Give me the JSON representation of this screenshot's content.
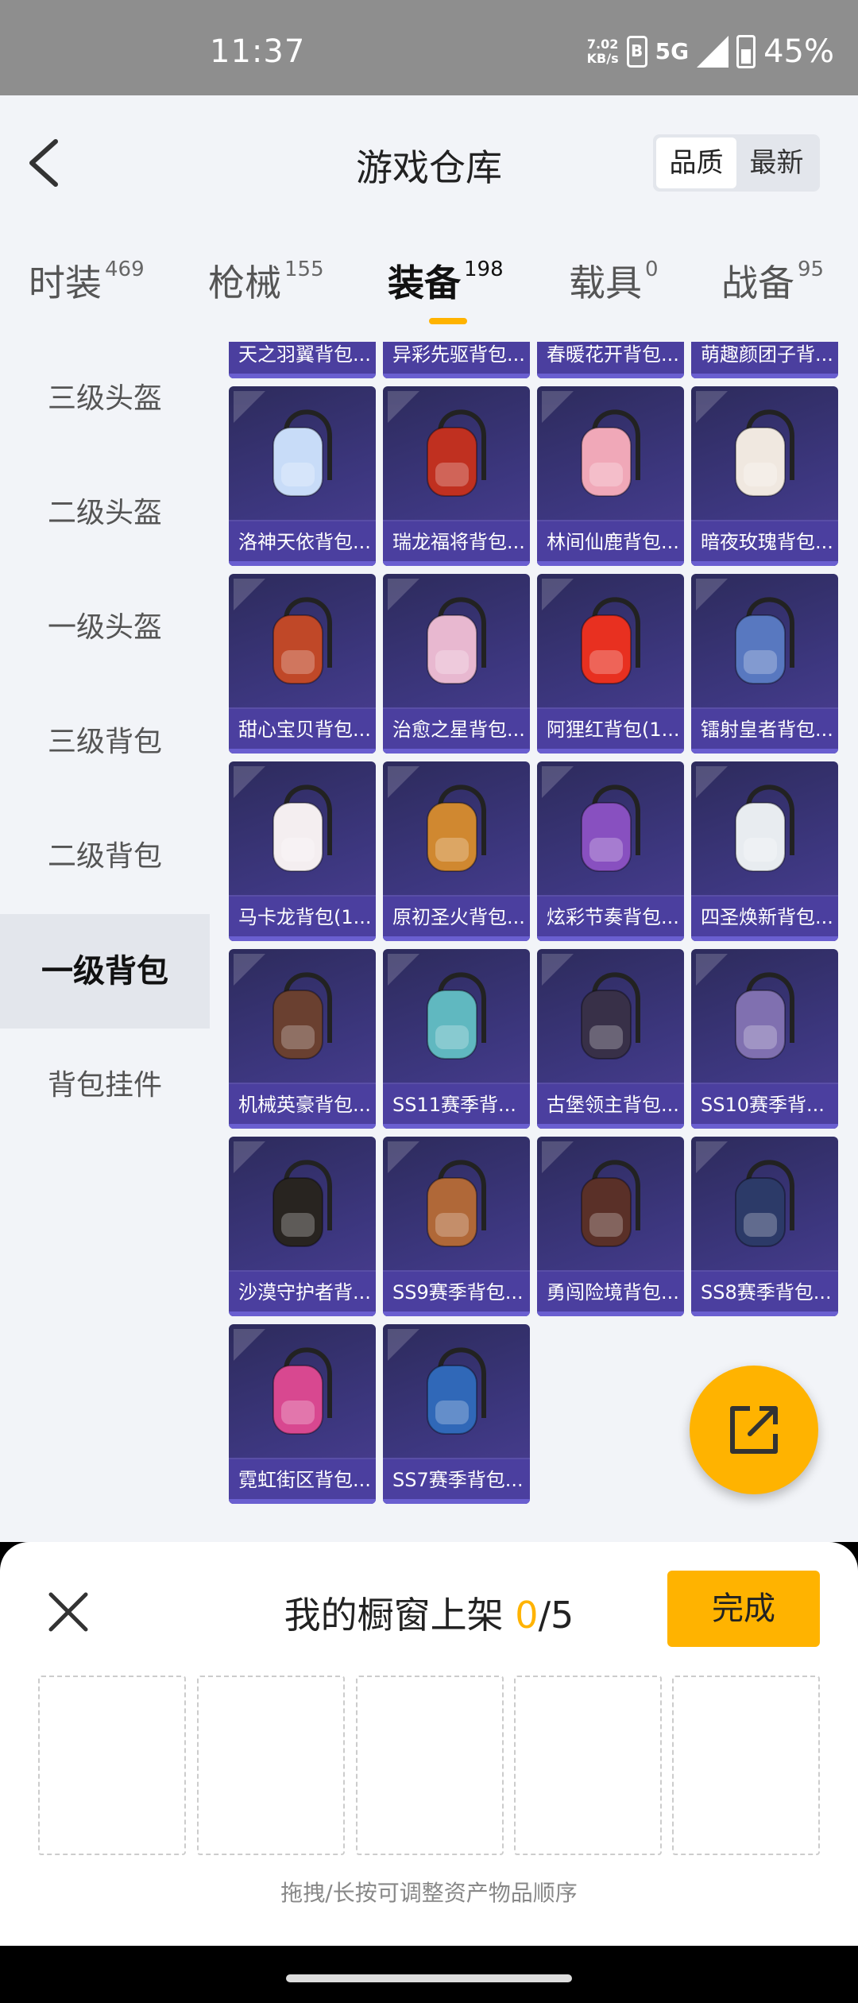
{
  "status_bar": {
    "time": "11:37",
    "net_speed_value": "7.02",
    "net_speed_unit": "KB/s",
    "network": "5G",
    "battery": "45%"
  },
  "header": {
    "title": "游戏仓库",
    "sort_options": [
      "品质",
      "最新"
    ],
    "sort_selected": "品质"
  },
  "tabs": [
    {
      "label": "时装",
      "count": "469"
    },
    {
      "label": "枪械",
      "count": "155"
    },
    {
      "label": "装备",
      "count": "198"
    },
    {
      "label": "载具",
      "count": "0"
    },
    {
      "label": "战备",
      "count": "95"
    }
  ],
  "active_tab": "装备",
  "sidebar": {
    "items": [
      "三级头盔",
      "二级头盔",
      "一级头盔",
      "三级背包",
      "二级背包",
      "一级背包",
      "背包挂件"
    ],
    "active": "一级背包"
  },
  "items": [
    {
      "name": "天之羽翼背包...",
      "icon": "backpack-icon",
      "color": "#a9c8f0"
    },
    {
      "name": "异彩先驱背包...",
      "icon": "backpack-icon",
      "color": "#8a8fc0"
    },
    {
      "name": "春暖花开背包...",
      "icon": "backpack-icon",
      "color": "#e0b8d0"
    },
    {
      "name": "萌趣颜团子背...",
      "icon": "backpack-icon",
      "color": "#e6d8c8"
    },
    {
      "name": "洛神天依背包...",
      "icon": "backpack-icon",
      "color": "#c8dcf8"
    },
    {
      "name": "瑞龙福将背包...",
      "icon": "backpack-icon",
      "color": "#c03020"
    },
    {
      "name": "林间仙鹿背包...",
      "icon": "backpack-icon",
      "color": "#f0a8b8"
    },
    {
      "name": "暗夜玫瑰背包...",
      "icon": "backpack-icon",
      "color": "#f0e8e0"
    },
    {
      "name": "甜心宝贝背包...",
      "icon": "backpack-icon",
      "color": "#c04828"
    },
    {
      "name": "治愈之星背包...",
      "icon": "backpack-icon",
      "color": "#e8b8d0"
    },
    {
      "name": "阿狸红背包(1...",
      "icon": "backpack-icon",
      "color": "#e83020"
    },
    {
      "name": "镭射皇者背包...",
      "icon": "backpack-icon",
      "color": "#5878c0"
    },
    {
      "name": "马卡龙背包(1...",
      "icon": "backpack-icon",
      "color": "#f4eef0"
    },
    {
      "name": "原初圣火背包...",
      "icon": "backpack-icon",
      "color": "#d08830"
    },
    {
      "name": "炫彩节奏背包...",
      "icon": "backpack-icon",
      "color": "#8850c0"
    },
    {
      "name": "四圣焕新背包...",
      "icon": "backpack-icon",
      "color": "#e8ecf0"
    },
    {
      "name": "机械英豪背包...",
      "icon": "backpack-icon",
      "color": "#6a4030"
    },
    {
      "name": "SS11赛季背...",
      "icon": "backpack-icon",
      "color": "#60b8c0"
    },
    {
      "name": "古堡领主背包...",
      "icon": "backpack-icon",
      "color": "#383048"
    },
    {
      "name": "SS10赛季背...",
      "icon": "backpack-icon",
      "color": "#8070b0"
    },
    {
      "name": "沙漠守护者背...",
      "icon": "backpack-icon",
      "color": "#282420"
    },
    {
      "name": "SS9赛季背包...",
      "icon": "backpack-icon",
      "color": "#b06838"
    },
    {
      "name": "勇闯险境背包...",
      "icon": "backpack-icon",
      "color": "#5a3028"
    },
    {
      "name": "SS8赛季背包...",
      "icon": "backpack-icon",
      "color": "#2c3a68"
    },
    {
      "name": "霓虹街区背包...",
      "icon": "backpack-icon",
      "color": "#d84890"
    },
    {
      "name": "SS7赛季背包...",
      "icon": "backpack-icon",
      "color": "#3068b8"
    }
  ],
  "showcase": {
    "title": "我的橱窗上架",
    "count": "0",
    "total": "/5",
    "done_label": "完成",
    "slots": 5,
    "hint": "拖拽/长按可调整资产物品顺序"
  },
  "colors": {
    "accent": "#ffb300",
    "card_bg": "#3d3780",
    "card_label_bg": "#4b3f9f",
    "page_bg": "#f2f4f8"
  }
}
